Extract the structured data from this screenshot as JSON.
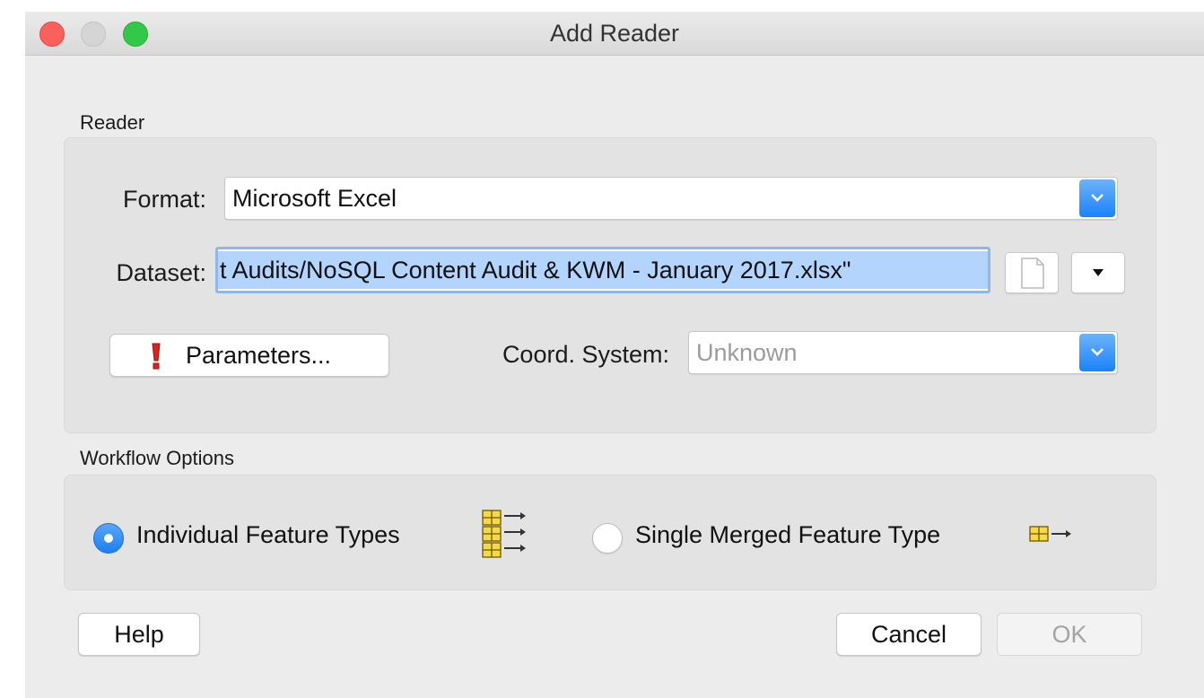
{
  "window": {
    "title": "Add Reader"
  },
  "reader_section": {
    "label": "Reader",
    "format": {
      "label": "Format:",
      "value": "Microsoft Excel"
    },
    "dataset": {
      "label": "Dataset:",
      "value": "t Audits/NoSQL Content Audit & KWM - January 2017.xlsx\""
    },
    "parameters_button": {
      "label": "Parameters...",
      "icon": "warning-exclamation-icon"
    },
    "coord_system": {
      "label": "Coord. System:",
      "value": "Unknown"
    }
  },
  "workflow_section": {
    "label": "Workflow Options",
    "options": [
      {
        "label": "Individual Feature Types",
        "selected": true,
        "icon": "multiple-tables-arrow-icon"
      },
      {
        "label": "Single Merged Feature Type",
        "selected": false,
        "icon": "single-table-arrow-icon"
      }
    ]
  },
  "footer": {
    "help_label": "Help",
    "cancel_label": "Cancel",
    "ok_label": "OK"
  },
  "colors": {
    "accent": "#1a82fb",
    "selection": "#b3d4fc",
    "close": "#fc605c",
    "maximize": "#34c84a"
  }
}
